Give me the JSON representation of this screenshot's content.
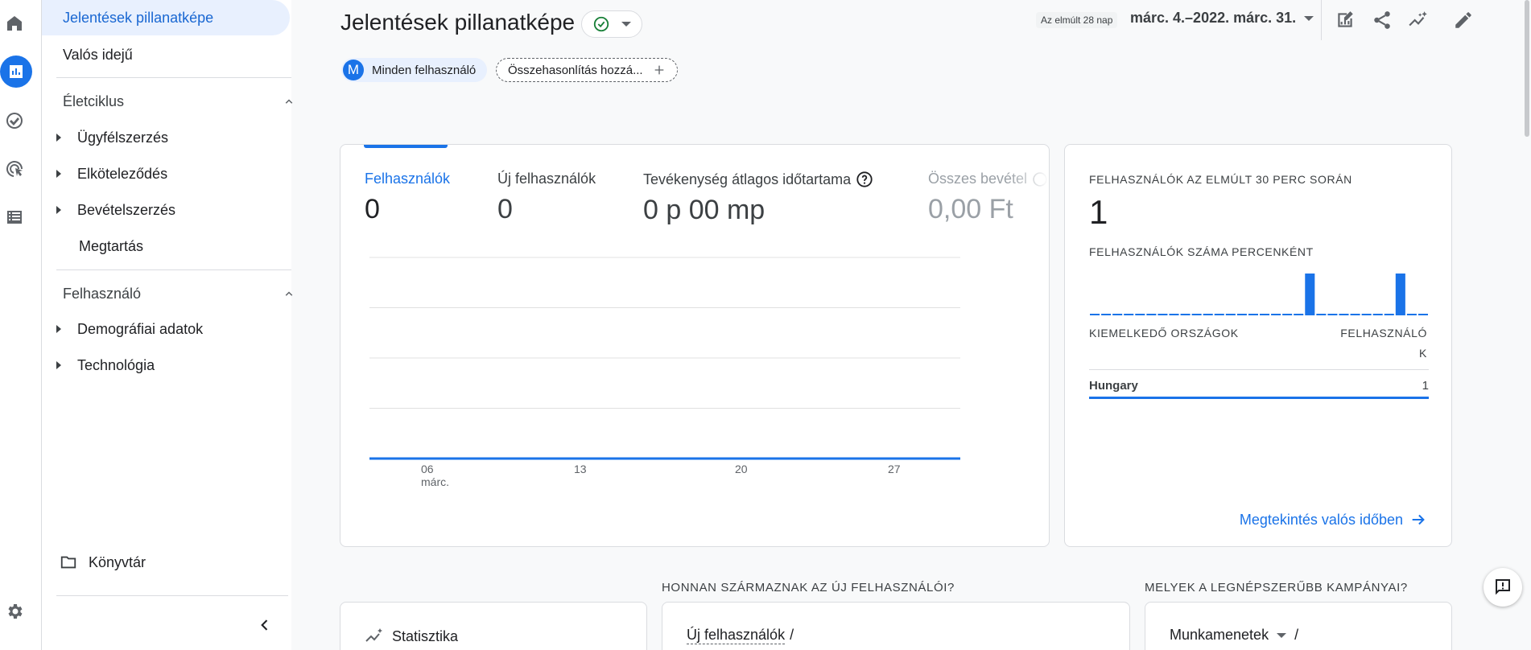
{
  "rail": {
    "icons": [
      "home-icon",
      "reports-icon",
      "explore-icon",
      "advertising-icon",
      "configure-icon",
      "settings-icon"
    ]
  },
  "nav": {
    "snapshot": "Jelentések pillanatképe",
    "realtime": "Valós idejű",
    "lifecycle": {
      "title": "Életciklus",
      "items": [
        "Ügyfélszerzés",
        "Elköteleződés",
        "Bevételszerzés"
      ],
      "retention": "Megtartás"
    },
    "user": {
      "title": "Felhasználó",
      "items": [
        "Demográfiai adatok",
        "Technológia"
      ]
    },
    "library": "Könyvtár"
  },
  "header": {
    "title": "Jelentések pillanatképe",
    "date_preset": "Az elmúlt 28 nap",
    "date_range": "márc. 4.–2022. márc. 31.",
    "chips": {
      "user_avatar": "M",
      "user_segment": "Minden felhasználó",
      "compare": "Összehasonlítás hozzá..."
    }
  },
  "main_card": {
    "metrics": [
      {
        "label": "Felhasználók",
        "value": "0"
      },
      {
        "label": "Új felhasználók",
        "value": "0"
      },
      {
        "label": "Tevékenység átlagos időtartama",
        "value": "0 p 00 mp"
      },
      {
        "label": "Összes bevétel",
        "value": "0,00 Ft"
      }
    ],
    "chart_data": {
      "type": "line",
      "x_ticks": [
        "06",
        "13",
        "20",
        "27"
      ],
      "x_tick_sub": "márc.",
      "series": [
        {
          "values": [
            0,
            0,
            0,
            0,
            0,
            0,
            0,
            0,
            0,
            0,
            0,
            0,
            0,
            0,
            0,
            0,
            0,
            0,
            0,
            0,
            0,
            0,
            0,
            0,
            0,
            0,
            0,
            0
          ]
        }
      ],
      "grid": true,
      "color": "#1a73e8"
    }
  },
  "realtime_card": {
    "users_30min_label": "FELHASZNÁLÓK AZ ELMÚLT 30 PERC SORÁN",
    "users_30min_value": "1",
    "per_minute_label": "FELHASZNÁLÓK SZÁMA PERCENKÉNT",
    "per_minute_bars": [
      0,
      0,
      0,
      0,
      0,
      0,
      0,
      0,
      0,
      0,
      0,
      0,
      0,
      0,
      0,
      0,
      0,
      0,
      0,
      1,
      0,
      0,
      0,
      0,
      0,
      0,
      0,
      1,
      0,
      0
    ],
    "top_countries_label": "KIEMELKEDŐ ORSZÁGOK",
    "users_col_label": "FELHASZNÁLÓ",
    "users_col_label_wrap": "K",
    "rows": [
      {
        "country": "Hungary",
        "value": "1"
      }
    ],
    "link": "Megtekintés valós időben"
  },
  "bottom": {
    "stats_title": "Statisztika",
    "new_users_question": "HONNAN SZÁRMAZNAK AZ ÚJ FELHASZNÁLÓI?",
    "new_users_dropdown": "Új felhasználók",
    "campaigns_question": "MELYEK A LEGNÉPSZERŰBB KAMPÁNYAI?",
    "sessions_dropdown": "Munkamenetek",
    "slash": "/"
  }
}
